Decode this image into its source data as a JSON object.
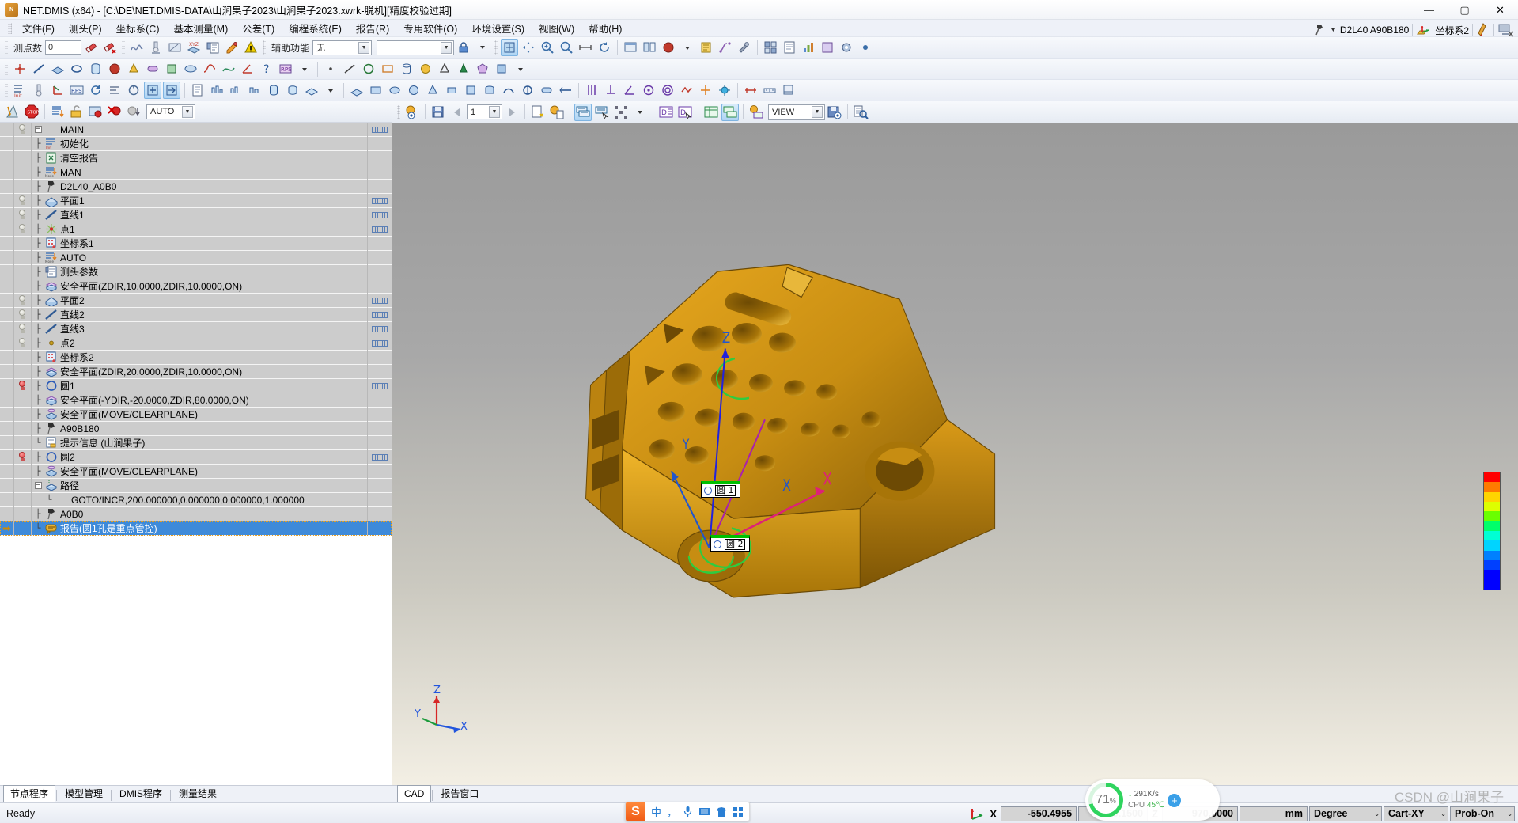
{
  "window": {
    "title": "NET.DMIS (x64) - [C:\\DE\\NET.DMIS-DATA\\山涧果子2023\\山涧果子2023.xwrk-脱机][精度校验过期]",
    "app_icon": "app-logo-icon",
    "minimize": "—",
    "maximize": "▢",
    "close": "✕"
  },
  "menu": [
    {
      "label": "文件(F)"
    },
    {
      "label": "测头(P)"
    },
    {
      "label": "坐标系(C)"
    },
    {
      "label": "基本测量(M)"
    },
    {
      "label": "公差(T)"
    },
    {
      "label": "编程系统(E)"
    },
    {
      "label": "报告(R)"
    },
    {
      "label": "专用软件(O)"
    },
    {
      "label": "环境设置(S)"
    },
    {
      "label": "视图(W)"
    },
    {
      "label": "帮助(H)"
    }
  ],
  "toolbar1": {
    "points_label": "测点数",
    "points_value": "0",
    "aux_label": "辅助功能",
    "aux_value": "无",
    "aux_value2": ""
  },
  "header_right": {
    "probe_name": "D2L40  A90B180",
    "coordsys_name": "坐标系2"
  },
  "left_toolbar": {
    "mode_value": "AUTO"
  },
  "tree": {
    "nodes": [
      {
        "label": "MAIN",
        "icon": "root-icon",
        "depth": 0,
        "expander": "minus",
        "bulb": "off",
        "mark": true,
        "connector": ""
      },
      {
        "label": "初始化",
        "icon": "init-icon",
        "depth": 1,
        "connector": "├",
        "bulb": "none",
        "mark": false
      },
      {
        "label": "清空报告",
        "icon": "clear-report-icon",
        "depth": 1,
        "connector": "├",
        "bulb": "none",
        "mark": false
      },
      {
        "label": "MAN",
        "icon": "mode-icon",
        "depth": 1,
        "connector": "├",
        "bulb": "none",
        "mark": false
      },
      {
        "label": "D2L40_A0B0",
        "icon": "probe-icon",
        "depth": 1,
        "connector": "├",
        "bulb": "none",
        "mark": false
      },
      {
        "label": "平面1",
        "icon": "plane-icon",
        "depth": 1,
        "connector": "├",
        "bulb": "off",
        "mark": true
      },
      {
        "label": "直线1",
        "icon": "line-icon",
        "depth": 1,
        "connector": "├",
        "bulb": "off",
        "mark": true
      },
      {
        "label": "点1",
        "icon": "point-icon",
        "depth": 1,
        "connector": "├",
        "bulb": "off",
        "mark": true
      },
      {
        "label": "坐标系1",
        "icon": "coordsys-icon",
        "depth": 1,
        "connector": "├",
        "bulb": "none",
        "mark": false
      },
      {
        "label": "AUTO",
        "icon": "mode-icon",
        "depth": 1,
        "connector": "├",
        "bulb": "none",
        "mark": false
      },
      {
        "label": "测头参数",
        "icon": "probe-param-icon",
        "depth": 1,
        "connector": "├",
        "bulb": "none",
        "mark": false
      },
      {
        "label": "安全平面(ZDIR,10.0000,ZDIR,10.0000,ON)",
        "icon": "safeplane-icon",
        "depth": 1,
        "connector": "├",
        "bulb": "none",
        "mark": false
      },
      {
        "label": "平面2",
        "icon": "plane-icon",
        "depth": 1,
        "connector": "├",
        "bulb": "off",
        "mark": true
      },
      {
        "label": "直线2",
        "icon": "line-icon",
        "depth": 1,
        "connector": "├",
        "bulb": "off",
        "mark": true
      },
      {
        "label": "直线3",
        "icon": "line-icon",
        "depth": 1,
        "connector": "├",
        "bulb": "off",
        "mark": true
      },
      {
        "label": "点2",
        "icon": "point2-icon",
        "depth": 1,
        "connector": "├",
        "bulb": "off",
        "mark": true
      },
      {
        "label": "坐标系2",
        "icon": "coordsys-icon",
        "depth": 1,
        "connector": "├",
        "bulb": "none",
        "mark": false
      },
      {
        "label": "安全平面(ZDIR,20.0000,ZDIR,10.0000,ON)",
        "icon": "safeplane-icon",
        "depth": 1,
        "connector": "├",
        "bulb": "none",
        "mark": false
      },
      {
        "label": "圆1",
        "icon": "circle-icon",
        "depth": 1,
        "connector": "├",
        "bulb": "on",
        "mark": true
      },
      {
        "label": "安全平面(-YDIR,-20.0000,ZDIR,80.0000,ON)",
        "icon": "safeplane-icon",
        "depth": 1,
        "connector": "├",
        "bulb": "none",
        "mark": false
      },
      {
        "label": "安全平面(MOVE/CLEARPLANE)",
        "icon": "safeplane2-icon",
        "depth": 1,
        "connector": "├",
        "bulb": "none",
        "mark": false
      },
      {
        "label": "A90B180",
        "icon": "probe-icon",
        "depth": 1,
        "connector": "├",
        "bulb": "none",
        "mark": false
      },
      {
        "label": "提示信息 (山涧果子)",
        "icon": "message-icon",
        "depth": 1,
        "connector": "└",
        "bulb": "none",
        "mark": false
      },
      {
        "label": "圆2",
        "icon": "circle-icon",
        "depth": 1,
        "connector": "├",
        "bulb": "on",
        "mark": true
      },
      {
        "label": "安全平面(MOVE/CLEARPLANE)",
        "icon": "safeplane2-icon",
        "depth": 1,
        "connector": "├",
        "bulb": "none",
        "mark": false
      },
      {
        "label": "路径",
        "icon": "path-icon",
        "depth": 1,
        "connector": "├",
        "expander": "minus",
        "bulb": "none",
        "mark": false
      },
      {
        "label": "GOTO/INCR,200.000000,0.000000,0.000000,1.000000",
        "icon": "none",
        "depth": 2,
        "connector": "└",
        "bulb": "none",
        "mark": false
      },
      {
        "label": "A0B0",
        "icon": "probe-icon",
        "depth": 1,
        "connector": "├",
        "bulb": "none",
        "mark": false
      },
      {
        "label": "报告(圆1孔是重点管控)",
        "icon": "report-icon",
        "depth": 1,
        "connector": "└",
        "bulb": "none",
        "mark": false,
        "selected": true,
        "current": true
      }
    ]
  },
  "left_tabs": [
    {
      "label": "节点程序",
      "active": true
    },
    {
      "label": "模型管理",
      "active": false
    },
    {
      "label": "DMIS程序",
      "active": false
    },
    {
      "label": "测量结果",
      "active": false
    }
  ],
  "cad_toolbar": {
    "page_value": "1",
    "view_value": "VIEW"
  },
  "cad_labels": [
    {
      "symbol": "⌀",
      "text": "圆 1"
    },
    {
      "symbol": "",
      "text": "圆 2"
    }
  ],
  "viewport_axes": {
    "x": "X",
    "y": "Y",
    "z": "Z"
  },
  "right_tabs": [
    {
      "label": "CAD",
      "active": true
    },
    {
      "label": "报告窗口",
      "active": false
    }
  ],
  "statusbar": {
    "ready": "Ready",
    "x_label": "X",
    "x_value": "-550.4955",
    "y_value": "989.1500",
    "z_label": "Z",
    "z_value": "970.0000",
    "unit_value": "mm",
    "angle_unit": "Degree",
    "coord_mode": "Cart-XY",
    "probe_state": "Prob-On"
  },
  "ime": {
    "logo": "S",
    "items": [
      "中",
      "，",
      "mic-icon",
      "keyboard-icon",
      "shirt-icon",
      "apps-icon"
    ]
  },
  "perf_widget": {
    "percent": "71",
    "percent_unit": "%",
    "net_speed": "291K/s",
    "cpu_label": "CPU",
    "cpu_temp": "45℃",
    "plus": "+"
  },
  "watermark": "CSDN @山涧果子",
  "colors": {
    "accent": "#3e8ad9",
    "tree_bg": "#cccccc",
    "model_gold": "#d19a1c",
    "selection": "#3e8ad9"
  }
}
